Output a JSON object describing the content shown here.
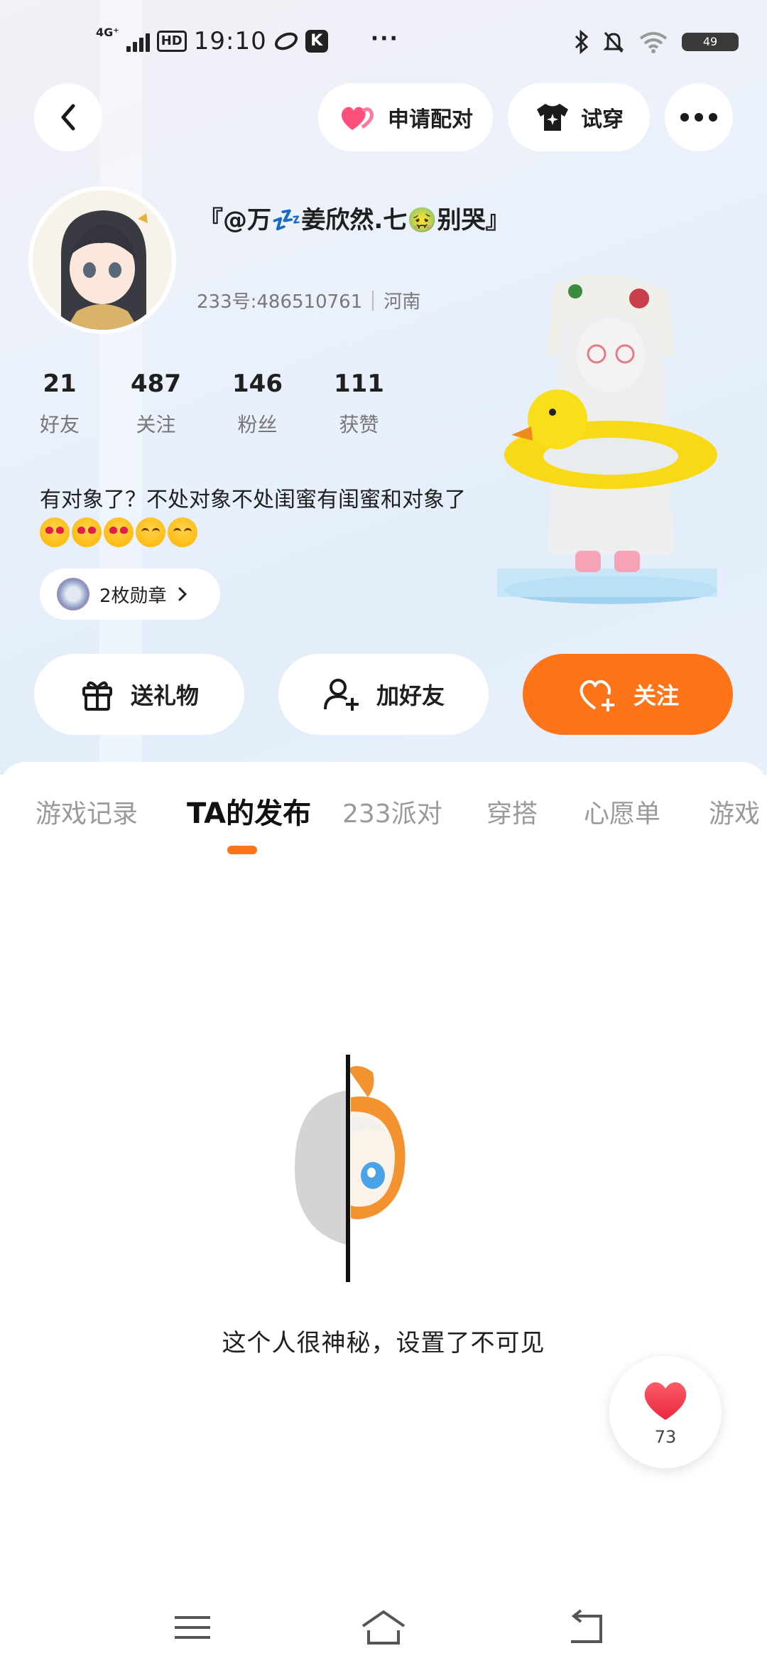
{
  "status_bar": {
    "network": "4G⁺",
    "hd": "HD",
    "time": "19:10",
    "k_badge": "K",
    "more": "···",
    "battery": "49"
  },
  "header": {
    "pair_label": "申请配对",
    "try_label": "试穿"
  },
  "profile": {
    "nickname": "『@万💤姜欣然.七🤢别哭』",
    "id_text": "233号:486510761",
    "location": "河南",
    "stats": [
      {
        "num": "21",
        "label": "好友"
      },
      {
        "num": "487",
        "label": "关注"
      },
      {
        "num": "146",
        "label": "粉丝"
      },
      {
        "num": "111",
        "label": "获赞"
      }
    ],
    "bio": "有对象了？不处对象不处闺蜜有闺蜜和对象了",
    "medal_label": "2枚勋章"
  },
  "actions": {
    "gift_label": "送礼物",
    "add_friend_label": "加好友",
    "follow_label": "关注"
  },
  "tabs": [
    {
      "label": "游戏记录"
    },
    {
      "label": "TA的发布"
    },
    {
      "label": "233派对"
    },
    {
      "label": "穿搭"
    },
    {
      "label": "心愿单"
    },
    {
      "label": "游戏"
    }
  ],
  "active_tab": "TA的发布",
  "empty_state": {
    "message": "这个人很神秘，设置了不可见"
  },
  "like_fab": {
    "count": "73"
  },
  "colors": {
    "accent": "#ff7418",
    "text": "#1f1f1f",
    "muted": "#9a9a9a"
  }
}
